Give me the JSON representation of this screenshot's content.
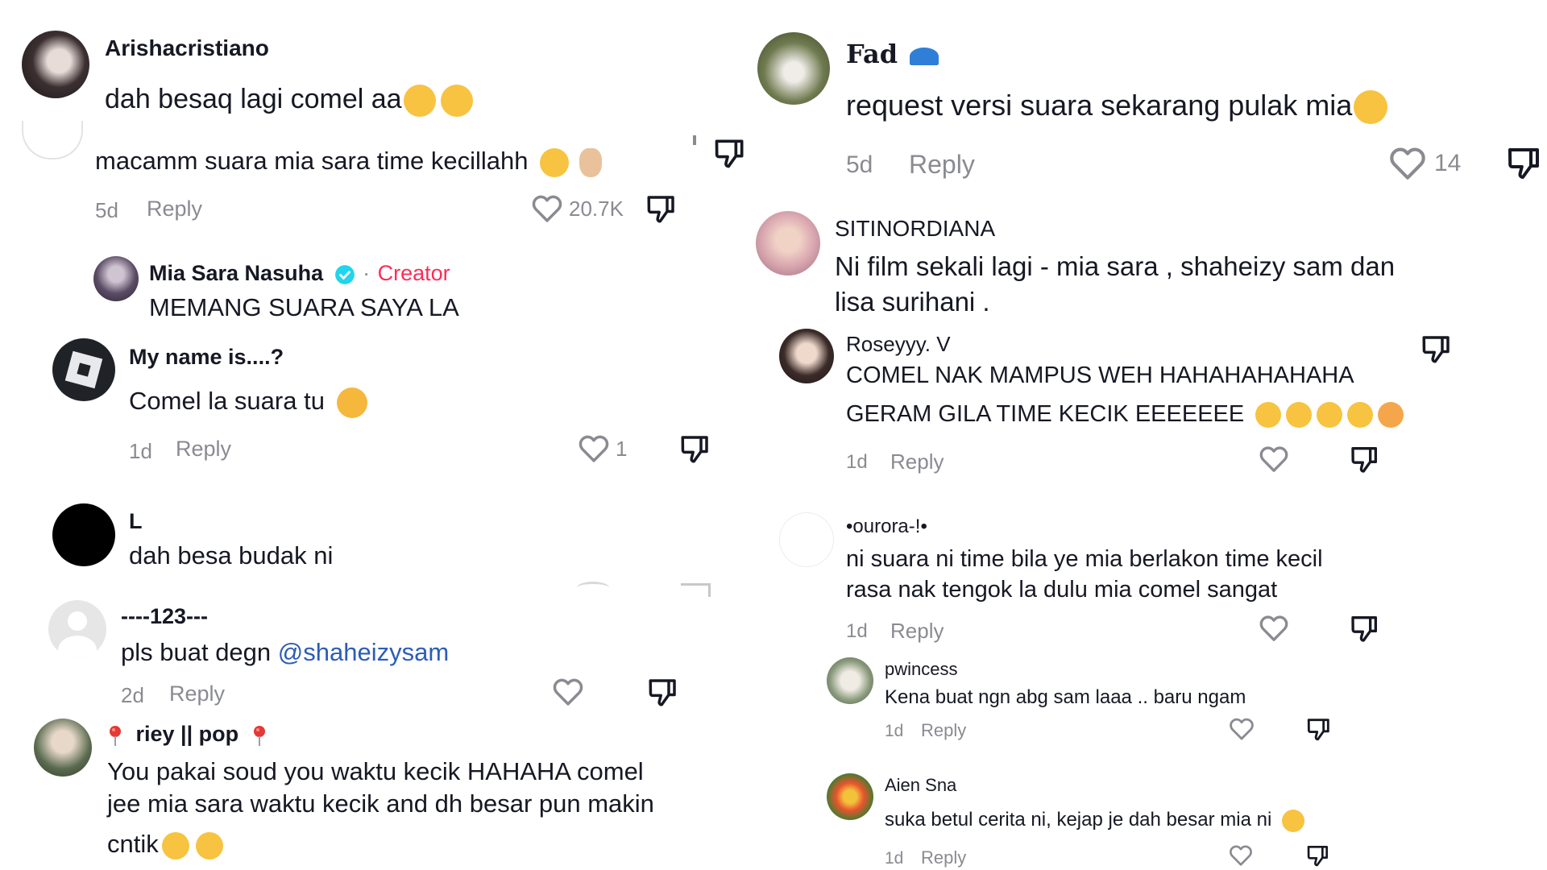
{
  "left": {
    "c1": {
      "user": "Arishacristiano",
      "text": "dah besaq lagi comel aa"
    },
    "c2": {
      "text": "macamm suara mia sara time kecillahh",
      "time": "5d",
      "reply": "Reply",
      "likes": "20.7K"
    },
    "r1": {
      "user": "Mia Sara Nasuha",
      "sep": "·",
      "badge": "Creator",
      "text": "MEMANG SUARA SAYA LA"
    },
    "c3": {
      "user": "My name is....?",
      "text": "Comel la suara tu",
      "time": "1d",
      "reply": "Reply",
      "likes": "1"
    },
    "c4": {
      "user": "L",
      "text": "dah besa budak ni"
    },
    "c5": {
      "user": "----123---",
      "text": "pls buat degn",
      "mention": "@shaheizysam",
      "time": "2d",
      "reply": "Reply"
    },
    "c6": {
      "user": "riey || pop",
      "line1": "You pakai soud you waktu kecik HAHAHA comel",
      "line2": "jee mia sara waktu kecik and dh besar pun makin",
      "line3": "cntik"
    }
  },
  "right": {
    "c1": {
      "user": "Fad",
      "text": "request versi suara sekarang pulak mia",
      "time": "5d",
      "reply": "Reply",
      "likes": "14"
    },
    "c2": {
      "user": "SITINORDIANA",
      "line1": "Ni film sekali lagi - mia sara , shaheizy sam dan",
      "line2": "lisa surihani ."
    },
    "c3": {
      "user": "Roseyyy. V",
      "line1": "COMEL NAK MAMPUS WEH HAHAHAHAHAHA",
      "line2": "GERAM GILA TIME KECIK EEEEEEE",
      "time": "1d",
      "reply": "Reply"
    },
    "c4": {
      "user": "•ourora-!•",
      "line1": "ni suara ni time bila ye mia berlakon time kecil",
      "line2": "rasa nak tengok la dulu mia comel sangat",
      "time": "1d",
      "reply": "Reply"
    },
    "c5": {
      "user": "pwincess",
      "text": "Kena buat ngn abg sam laaa .. baru ngam",
      "time": "1d",
      "reply": "Reply"
    },
    "c6": {
      "user": "Aien Sna",
      "text": "suka betul cerita ni, kejap je dah besar mia ni",
      "time": "1d",
      "reply": "Reply"
    }
  },
  "colors": {
    "muted": "#8a8b91",
    "mention": "#2b5db9",
    "creator": "#fe2c55",
    "verified": "#20d5ec"
  },
  "icons": {
    "like": "heart-outline-icon",
    "dislike": "thumbs-down-icon",
    "verified": "verified-check-icon",
    "pin": "pin-icon"
  }
}
